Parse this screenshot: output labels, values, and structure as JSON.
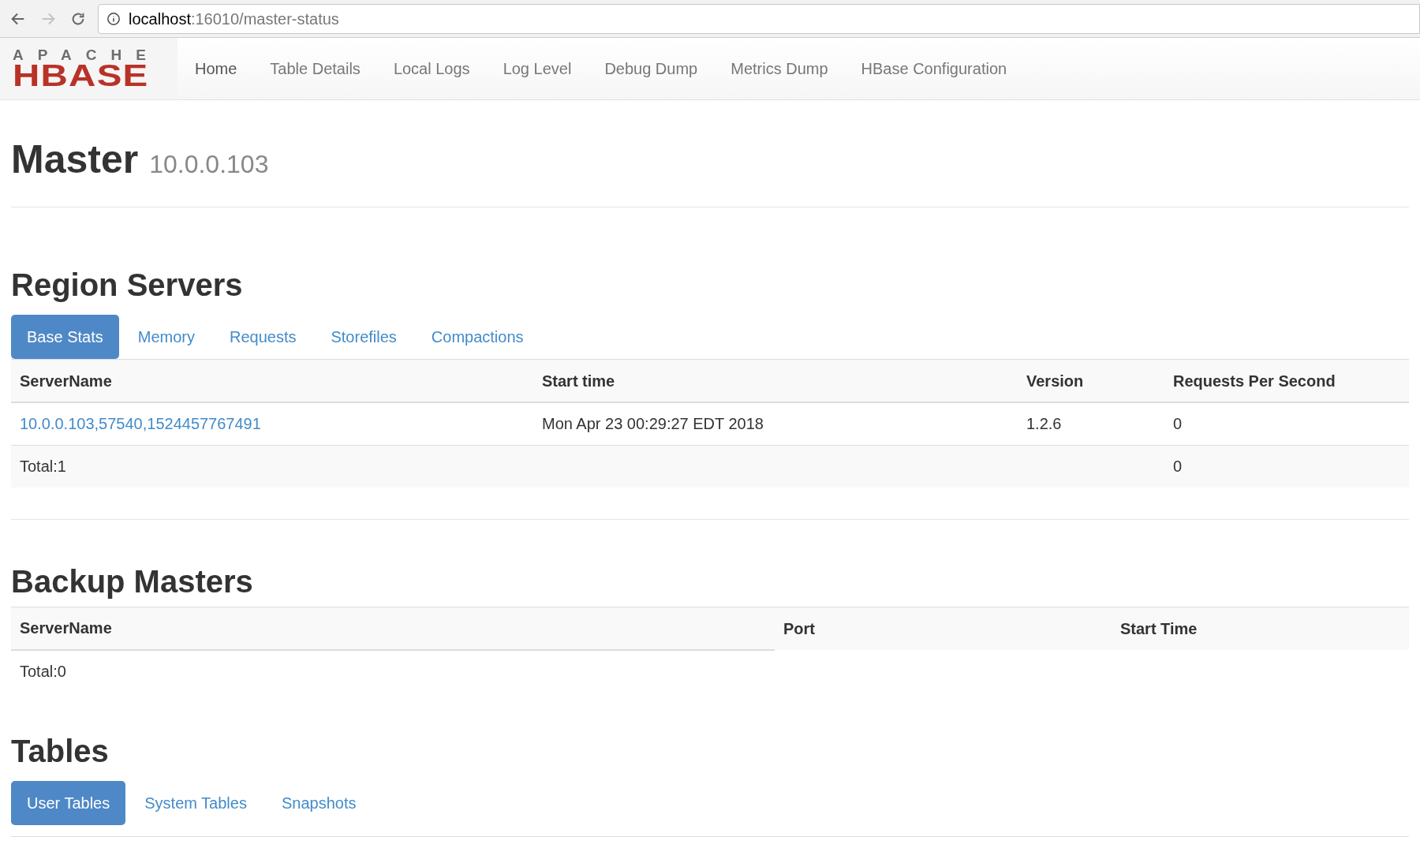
{
  "browser": {
    "address": {
      "host": "localhost",
      "path": ":16010/master-status"
    }
  },
  "logo": {
    "top": "APACHE",
    "bottom": "HBASE"
  },
  "nav": [
    {
      "label": "Home",
      "selected": true
    },
    {
      "label": "Table Details",
      "selected": false
    },
    {
      "label": "Local Logs",
      "selected": false
    },
    {
      "label": "Log Level",
      "selected": false
    },
    {
      "label": "Debug Dump",
      "selected": false
    },
    {
      "label": "Metrics Dump",
      "selected": false
    },
    {
      "label": "HBase Configuration",
      "selected": false
    }
  ],
  "page_title": {
    "title": "Master",
    "subtitle": "10.0.0.103"
  },
  "region_servers": {
    "heading": "Region Servers",
    "tabs": [
      {
        "label": "Base Stats",
        "selected": true
      },
      {
        "label": "Memory",
        "selected": false
      },
      {
        "label": "Requests",
        "selected": false
      },
      {
        "label": "Storefiles",
        "selected": false
      },
      {
        "label": "Compactions",
        "selected": false
      }
    ],
    "columns": [
      "ServerName",
      "Start time",
      "Version",
      "Requests Per Second"
    ],
    "rows": [
      {
        "server": "10.0.0.103,57540,1524457767491",
        "start_time": "Mon Apr 23 00:29:27 EDT 2018",
        "version": "1.2.6",
        "requests": "0"
      }
    ],
    "total": {
      "label": "Total:1",
      "requests": "0"
    }
  },
  "backup_masters": {
    "heading": "Backup Masters",
    "columns": [
      "ServerName",
      "Port",
      "Start Time"
    ],
    "total": "Total:0"
  },
  "tables": {
    "heading": "Tables",
    "tabs": [
      {
        "label": "User Tables",
        "selected": true
      },
      {
        "label": "System Tables",
        "selected": false
      },
      {
        "label": "Snapshots",
        "selected": false
      }
    ]
  }
}
